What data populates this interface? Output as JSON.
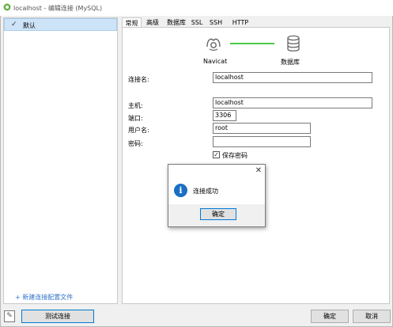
{
  "window": {
    "title": "localhost - 编辑连接 (MySQL)"
  },
  "sidebar": {
    "items": [
      {
        "label": "默认",
        "selected": true
      }
    ],
    "new_profile_link": "+ 新建连接配置文件"
  },
  "tabs": [
    {
      "label": "常规",
      "active": true
    },
    {
      "label": "高级"
    },
    {
      "label": "数据库"
    },
    {
      "label": "SSL"
    },
    {
      "label": "SSH"
    },
    {
      "label": "HTTP"
    }
  ],
  "diagram": {
    "left_label": "Navicat",
    "right_label": "数据库",
    "connector_color": "#4bc94b"
  },
  "form": {
    "connection_name": {
      "label": "连接名:",
      "value": "localhost"
    },
    "host": {
      "label": "主机:",
      "value": "localhost"
    },
    "port": {
      "label": "端口:",
      "value": "3306"
    },
    "username": {
      "label": "用户名:",
      "value": "root"
    },
    "password": {
      "label": "密码:",
      "value": ""
    },
    "save_password": {
      "label": "保存密码",
      "checked": true
    }
  },
  "dialog": {
    "message": "连接成功",
    "ok_label": "确定",
    "icon": "info-icon",
    "close_glyph": "✕"
  },
  "footer": {
    "test_connection_label": "测试连接",
    "ok_label": "确定",
    "cancel_label": "取消"
  },
  "colors": {
    "accent": "#0078d7",
    "link": "#2f73c9",
    "selection": "#cde3f7"
  }
}
